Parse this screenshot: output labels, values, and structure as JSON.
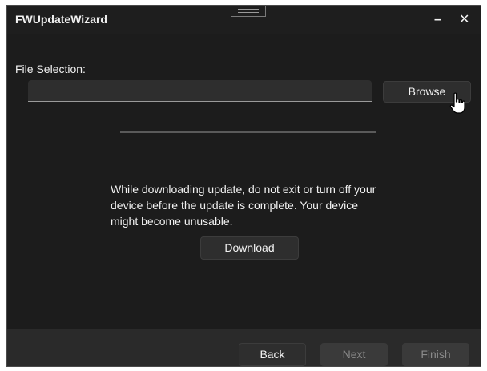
{
  "window": {
    "title": "FWUpdateWizard",
    "minimize_glyph": "–",
    "close_glyph": "✕"
  },
  "file_selection": {
    "label": "File Selection:",
    "value": "",
    "placeholder": "",
    "browse_label": "Browse"
  },
  "progress": {
    "fraction": 0.0
  },
  "warning": {
    "text": "While downloading update, do not exit or turn off your device before the update is complete. Your device might become unusable."
  },
  "download_label": "Download",
  "footer": {
    "back_label": "Back",
    "next_label": "Next",
    "finish_label": "Finish"
  },
  "icons": {
    "drag_handle": "drag-handle-icon",
    "cursor": "hand-pointer-icon"
  },
  "colors": {
    "background": "#1c1c1c",
    "footer": "#2a2a2a",
    "button": "#2e2e2e",
    "button_disabled": "#3a3a3a",
    "text": "#f2f2f2",
    "text_disabled": "#8a8a8a"
  }
}
